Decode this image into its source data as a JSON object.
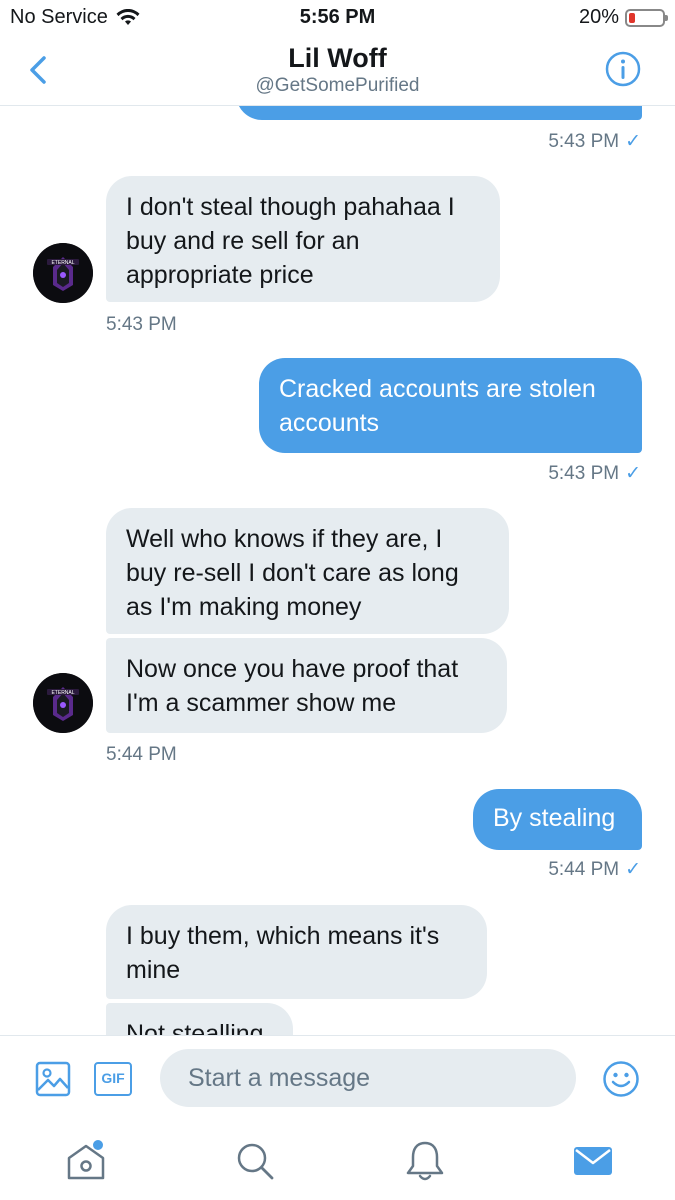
{
  "status_bar": {
    "carrier": "No Service",
    "time": "5:56 PM",
    "battery": "20%",
    "battery_level": 0.2
  },
  "header": {
    "name": "Lil Woff",
    "handle": "@GetSomePurified"
  },
  "messages": {
    "ts1": "5:43 PM",
    "m1": "I don't steal though pahahaa I buy and re sell for an appropriate price",
    "ts2": "5:43 PM",
    "m2": "Cracked accounts are stolen accounts",
    "ts3": "5:43 PM",
    "m3": "Well who knows if they are, I buy re-sell I don't care as long as I'm making money",
    "m4": "Now once you have proof that I'm a scammer show me",
    "ts4": "5:44 PM",
    "m5": "By stealing",
    "ts5": "5:44 PM",
    "m6": "I buy them, which means it's mine",
    "m7": "Not stealling",
    "read_check": "✓"
  },
  "composer": {
    "placeholder": "Start a message",
    "gif_label": "GIF"
  },
  "colors": {
    "accent": "#4b9ee6",
    "incoming_bubble": "#e6ecf0"
  },
  "icons": [
    "wifi-icon",
    "battery-icon",
    "back-chevron-icon",
    "info-icon",
    "image-icon",
    "gif-icon",
    "emoji-icon",
    "home-icon",
    "search-icon",
    "notifications-icon",
    "messages-icon"
  ]
}
